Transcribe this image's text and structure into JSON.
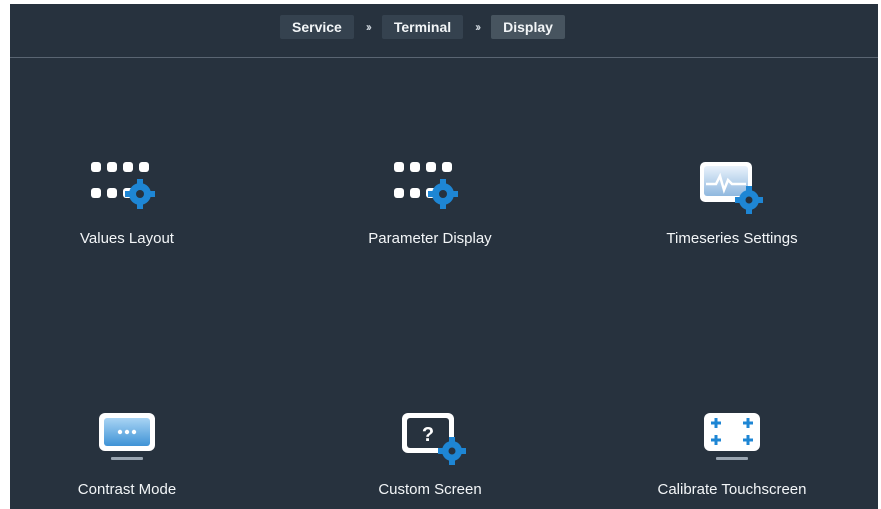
{
  "breadcrumb": {
    "items": [
      "Service",
      "Terminal",
      "Display"
    ],
    "separator": "››"
  },
  "tiles": [
    {
      "label": "Values Layout",
      "icon": "values-layout-icon"
    },
    {
      "label": "Parameter Display",
      "icon": "parameter-display-icon"
    },
    {
      "label": "Timeseries Settings",
      "icon": "timeseries-settings-icon"
    },
    {
      "label": "Contrast Mode",
      "icon": "contrast-mode-icon"
    },
    {
      "label": "Custom Screen",
      "icon": "custom-screen-icon"
    },
    {
      "label": "Calibrate Touchscreen",
      "icon": "calibrate-touchscreen-icon"
    }
  ],
  "colors": {
    "background": "#27323e",
    "crumb": "#35424f",
    "accent_blue": "#1e86d4",
    "text": "#f3f6f8"
  }
}
